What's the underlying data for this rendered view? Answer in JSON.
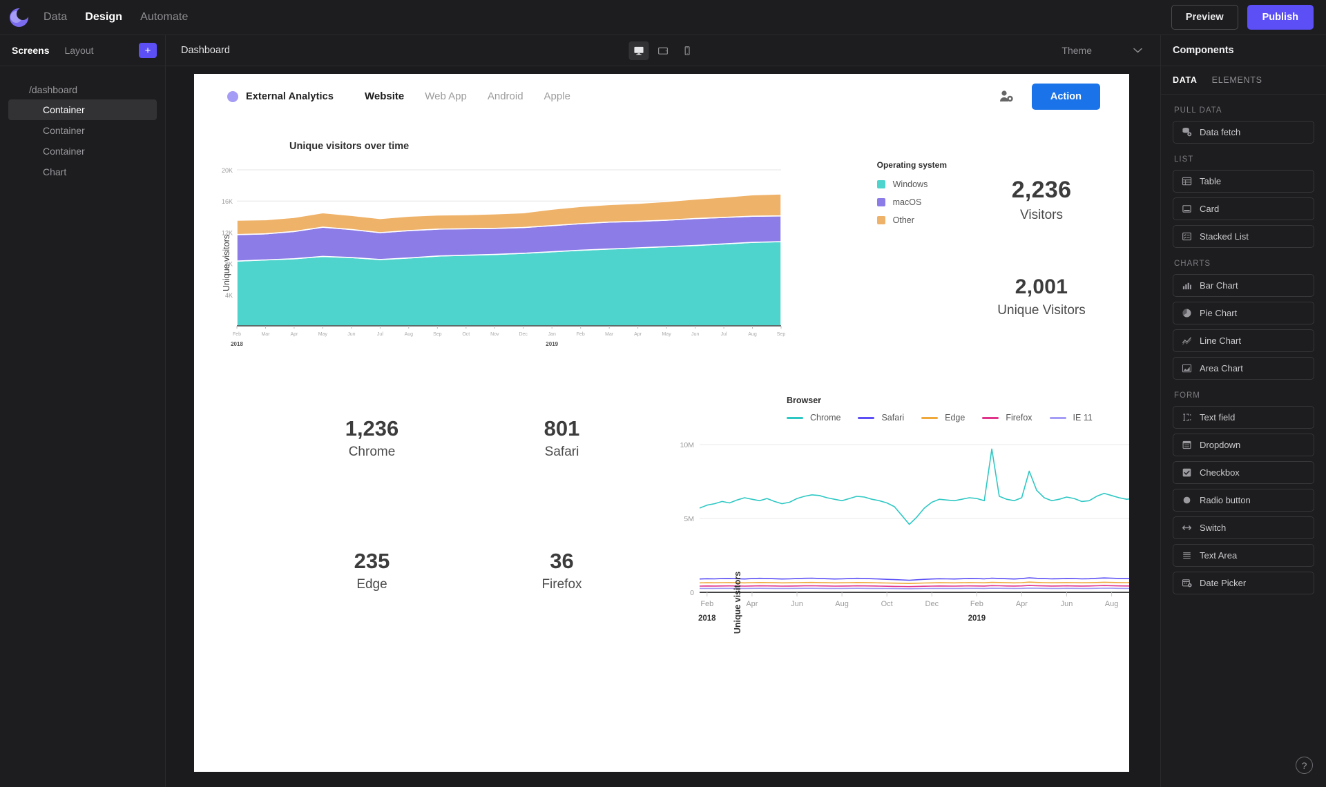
{
  "topbar": {
    "logo": "app-logo-mark",
    "nav": [
      {
        "label": "Data",
        "active": false
      },
      {
        "label": "Design",
        "active": true
      },
      {
        "label": "Automate",
        "active": false
      }
    ],
    "preview_label": "Preview",
    "publish_label": "Publish",
    "publish_color": "#5b4ff5"
  },
  "sidebar": {
    "tabs": [
      {
        "label": "Screens",
        "active": true
      },
      {
        "label": "Layout",
        "active": false
      }
    ],
    "add_label": "+",
    "root": "/dashboard",
    "items": [
      {
        "label": "Container",
        "selected": true
      },
      {
        "label": "Container",
        "selected": false
      },
      {
        "label": "Container",
        "selected": false
      },
      {
        "label": "Chart",
        "selected": false
      }
    ]
  },
  "canvas_bar": {
    "title": "Dashboard",
    "devices": [
      {
        "name": "desktop",
        "active": true
      },
      {
        "name": "tablet",
        "active": false
      },
      {
        "name": "mobile",
        "active": false
      }
    ],
    "theme_label": "Theme"
  },
  "app": {
    "brand": "External Analytics",
    "tabs": [
      {
        "label": "Website",
        "active": true
      },
      {
        "label": "Web App",
        "active": false
      },
      {
        "label": "Android",
        "active": false
      },
      {
        "label": "Apple",
        "active": false
      }
    ],
    "user_icon": "user-settings-icon",
    "action_label": "Action",
    "action_color": "#1a73e8"
  },
  "stats": {
    "visitors": {
      "value": "2,236",
      "label": "Visitors"
    },
    "unique_visitors": {
      "value": "2,001",
      "label": "Unique Visitors"
    }
  },
  "browser_stats": [
    {
      "value": "1,236",
      "label": "Chrome"
    },
    {
      "value": "801",
      "label": "Safari"
    },
    {
      "value": "235",
      "label": "Edge"
    },
    {
      "value": "36",
      "label": "Firefox"
    }
  ],
  "components_panel": {
    "title": "Components",
    "tabs": [
      {
        "label": "DATA",
        "active": true
      },
      {
        "label": "ELEMENTS",
        "active": false
      }
    ],
    "sections": [
      {
        "label": "PULL DATA",
        "items": [
          {
            "label": "Data fetch",
            "icon": "database-add-icon"
          }
        ]
      },
      {
        "label": "LIST",
        "items": [
          {
            "label": "Table",
            "icon": "table-icon"
          },
          {
            "label": "Card",
            "icon": "card-icon"
          },
          {
            "label": "Stacked List",
            "icon": "stacked-list-icon"
          }
        ]
      },
      {
        "label": "CHARTS",
        "items": [
          {
            "label": "Bar Chart",
            "icon": "bar-chart-icon"
          },
          {
            "label": "Pie Chart",
            "icon": "pie-chart-icon"
          },
          {
            "label": "Line Chart",
            "icon": "line-chart-icon"
          },
          {
            "label": "Area Chart",
            "icon": "area-chart-icon"
          }
        ]
      },
      {
        "label": "FORM",
        "items": [
          {
            "label": "Text field",
            "icon": "text-field-icon"
          },
          {
            "label": "Dropdown",
            "icon": "dropdown-icon"
          },
          {
            "label": "Checkbox",
            "icon": "checkbox-icon"
          },
          {
            "label": "Radio button",
            "icon": "radio-button-icon"
          },
          {
            "label": "Switch",
            "icon": "switch-icon"
          },
          {
            "label": "Text Area",
            "icon": "text-area-icon"
          },
          {
            "label": "Date Picker",
            "icon": "date-picker-icon"
          }
        ]
      }
    ],
    "help_label": "?"
  },
  "chart_data": [
    {
      "type": "area",
      "title": "Unique visitors over time",
      "xlabel": "",
      "ylabel": "Unique visitors",
      "ylim": [
        0,
        20000
      ],
      "yticks": [
        "4K",
        "8K",
        "12K",
        "16K",
        "20K"
      ],
      "ytick_values": [
        4000,
        8000,
        12000,
        16000,
        20000
      ],
      "grid": true,
      "stacked": true,
      "legend_title": "Operating system",
      "legend_position": "right",
      "x": [
        "Feb",
        "Mar",
        "Apr",
        "May",
        "Jun",
        "Jul",
        "Aug",
        "Sep",
        "Oct",
        "Nov",
        "Dec",
        "Jan",
        "Feb",
        "Mar",
        "Apr",
        "May",
        "Jun",
        "Jul",
        "Aug",
        "Sep"
      ],
      "year_labels": [
        {
          "label": "2018",
          "x_index": 0
        },
        {
          "label": "2019",
          "x_index": 11
        }
      ],
      "series": [
        {
          "name": "Windows",
          "color": "#4fd4cd",
          "values": [
            8300,
            8450,
            8600,
            8900,
            8750,
            8500,
            8700,
            8950,
            9050,
            9150,
            9300,
            9500,
            9700,
            9850,
            10000,
            10150,
            10300,
            10500,
            10700,
            10800
          ]
        },
        {
          "name": "macOS",
          "color": "#8b7ce8",
          "values": [
            3400,
            3350,
            3500,
            3750,
            3600,
            3450,
            3500,
            3450,
            3400,
            3350,
            3300,
            3350,
            3400,
            3450,
            3400,
            3400,
            3450,
            3400,
            3350,
            3300
          ]
        },
        {
          "name": "Other",
          "color": "#efb269",
          "values": [
            1850,
            1800,
            1800,
            1850,
            1800,
            1800,
            1850,
            1800,
            1800,
            1850,
            1900,
            2100,
            2200,
            2250,
            2300,
            2400,
            2500,
            2600,
            2750,
            2800
          ]
        }
      ]
    },
    {
      "type": "line",
      "title": "",
      "xlabel": "",
      "ylabel": "Unique visitors",
      "ylim": [
        0,
        10000000
      ],
      "yticks": [
        "0",
        "5M",
        "10M"
      ],
      "ytick_values": [
        0,
        5000000,
        10000000
      ],
      "grid": true,
      "legend_title": "Browser",
      "legend_position": "top",
      "xticks": [
        "Feb",
        "Apr",
        "Jun",
        "Aug",
        "Oct",
        "Dec",
        "Feb",
        "Apr",
        "Jun",
        "Aug"
      ],
      "year_labels": [
        {
          "label": "2018",
          "x_index": 0
        },
        {
          "label": "2019",
          "x_index": 6
        }
      ],
      "series": [
        {
          "name": "Chrome",
          "color": "#2ec8c4",
          "values": [
            5700,
            5900,
            6000,
            6150,
            6050,
            6250,
            6400,
            6300,
            6200,
            6350,
            6150,
            6000,
            6100,
            6350,
            6500,
            6600,
            6550,
            6400,
            6300,
            6200,
            6350,
            6500,
            6450,
            6300,
            6200,
            6050,
            5800,
            5200,
            4600,
            5100,
            5700,
            6100,
            6300,
            6250,
            6200,
            6300,
            6400,
            6350,
            6200,
            9700,
            6500,
            6300,
            6200,
            6400,
            8200,
            6900,
            6400,
            6200,
            6300,
            6450,
            6350,
            6150,
            6200,
            6500,
            6700,
            6550,
            6400,
            6300,
            6350,
            6400
          ]
        },
        {
          "name": "Safari",
          "color": "#5b4ff5",
          "values": [
            900,
            920,
            910,
            930,
            940,
            920,
            900,
            930,
            950,
            940,
            920,
            900,
            910,
            930,
            950,
            960,
            940,
            920,
            900,
            910,
            930,
            950,
            940,
            920,
            900,
            880,
            860,
            840,
            820,
            850,
            880,
            900,
            920,
            910,
            900,
            920,
            940,
            930,
            910,
            960,
            940,
            920,
            900,
            930,
            980,
            950,
            930,
            910,
            920,
            940,
            930,
            910,
            920,
            950,
            970,
            960,
            940,
            930,
            940,
            950
          ]
        },
        {
          "name": "Edge",
          "color": "#efa93a",
          "values": [
            640,
            650,
            645,
            655,
            660,
            650,
            640,
            655,
            665,
            660,
            650,
            640,
            645,
            655,
            665,
            670,
            660,
            650,
            640,
            645,
            655,
            665,
            660,
            650,
            640,
            630,
            620,
            610,
            600,
            615,
            630,
            640,
            650,
            645,
            640,
            650,
            660,
            655,
            645,
            675,
            665,
            650,
            640,
            655,
            690,
            670,
            655,
            645,
            650,
            660,
            655,
            645,
            650,
            665,
            680,
            670,
            660,
            655,
            660,
            665
          ]
        },
        {
          "name": "Firefox",
          "color": "#e0348b",
          "values": [
            420,
            428,
            424,
            432,
            436,
            428,
            420,
            432,
            440,
            436,
            428,
            420,
            424,
            432,
            440,
            444,
            436,
            428,
            420,
            424,
            432,
            440,
            436,
            428,
            420,
            412,
            404,
            396,
            388,
            400,
            412,
            420,
            428,
            424,
            420,
            428,
            436,
            432,
            424,
            452,
            444,
            432,
            424,
            436,
            464,
            448,
            436,
            424,
            428,
            440,
            432,
            424,
            428,
            444,
            456,
            448,
            436,
            428,
            436,
            440
          ]
        },
        {
          "name": "IE 11",
          "color": "#a49cf5",
          "values": [
            260,
            264,
            262,
            266,
            268,
            264,
            260,
            266,
            270,
            268,
            264,
            260,
            262,
            266,
            270,
            272,
            268,
            264,
            260,
            262,
            266,
            270,
            268,
            264,
            260,
            256,
            252,
            248,
            244,
            250,
            256,
            260,
            264,
            262,
            260,
            264,
            268,
            266,
            262,
            278,
            272,
            266,
            260,
            266,
            286,
            276,
            268,
            262,
            264,
            270,
            266,
            262,
            264,
            272,
            280,
            274,
            268,
            264,
            268,
            270
          ]
        }
      ]
    }
  ]
}
